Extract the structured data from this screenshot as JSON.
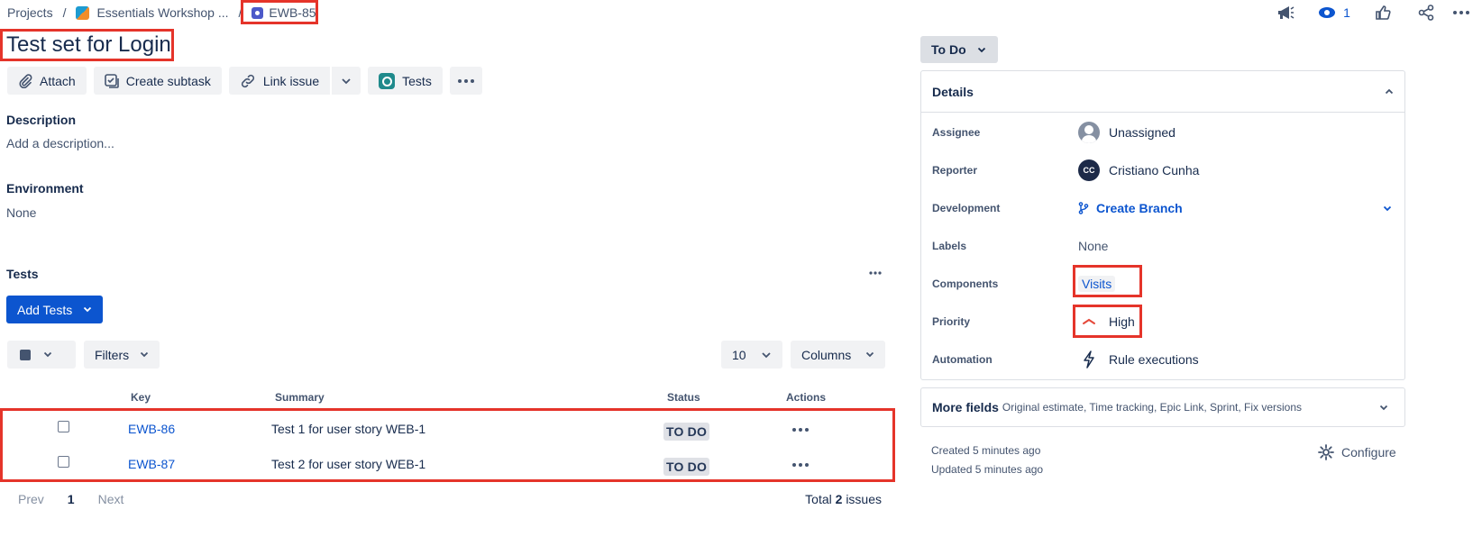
{
  "breadcrumb": {
    "projects": "Projects",
    "separator": "/",
    "project": "Essentials Workshop ...",
    "issue_key": "EWB-85"
  },
  "top_actions": {
    "watch_count": "1"
  },
  "issue": {
    "title": "Test set for Login"
  },
  "toolbar": {
    "attach": "Attach",
    "create_subtask": "Create subtask",
    "link_issue": "Link issue",
    "tests": "Tests"
  },
  "description": {
    "heading": "Description",
    "placeholder": "Add a description..."
  },
  "environment": {
    "heading": "Environment",
    "value": "None"
  },
  "tests_section": {
    "heading": "Tests",
    "add_tests": "Add Tests",
    "filters": "Filters",
    "page_size": "10",
    "columns": "Columns",
    "columns_header": {
      "key": "Key",
      "summary": "Summary",
      "status": "Status",
      "actions": "Actions"
    },
    "rows": [
      {
        "key": "EWB-86",
        "summary": "Test 1 for user story WEB-1",
        "status": "TO DO"
      },
      {
        "key": "EWB-87",
        "summary": "Test 2 for user story WEB-1",
        "status": "TO DO"
      }
    ],
    "pager": {
      "prev": "Prev",
      "current": "1",
      "next": "Next"
    },
    "total_prefix": "Total",
    "total_count": "2",
    "total_suffix": "issues"
  },
  "status_button": "To Do",
  "details": {
    "heading": "Details",
    "assignee_label": "Assignee",
    "assignee_value": "Unassigned",
    "reporter_label": "Reporter",
    "reporter_initials": "CC",
    "reporter_value": "Cristiano Cunha",
    "development_label": "Development",
    "development_value": "Create Branch",
    "labels_label": "Labels",
    "labels_value": "None",
    "components_label": "Components",
    "components_value": "Visits",
    "priority_label": "Priority",
    "priority_value": "High",
    "automation_label": "Automation",
    "automation_value": "Rule executions"
  },
  "more_fields": {
    "title": "More fields",
    "subtitle": "Original estimate, Time tracking, Epic Link, Sprint, Fix versions"
  },
  "meta": {
    "created": "Created 5 minutes ago",
    "updated": "Updated 5 minutes ago",
    "configure": "Configure"
  },
  "colors": {
    "primary": "#0c55cf",
    "highlight": "#e5342a",
    "priority_high": "#e5493a"
  }
}
